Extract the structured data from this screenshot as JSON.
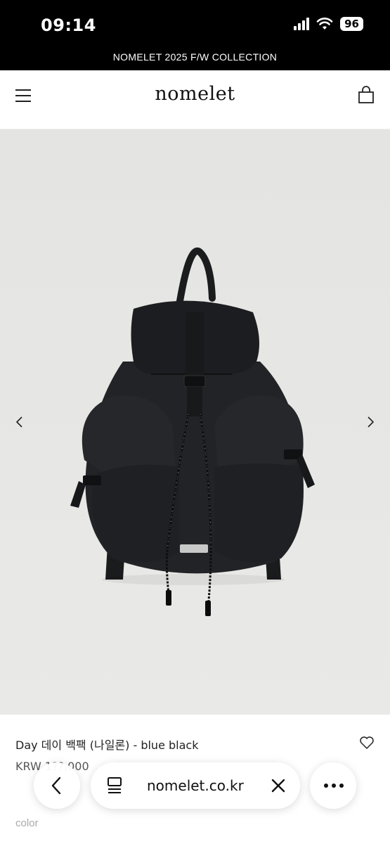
{
  "status_bar": {
    "time": "09:14",
    "battery": "96"
  },
  "announcement": {
    "text": "NOMELET 2025 F/W COLLECTION"
  },
  "header": {
    "logo": "nomelet"
  },
  "product": {
    "name": "Day 데이 백팩 (나일론) - blue black",
    "price": "KRW 1??,000",
    "option_label": "color"
  },
  "browser": {
    "url": "nomelet.co.kr"
  },
  "icons": {
    "menu": "hamburger-icon",
    "cart": "shopping-bag-icon",
    "prev": "chevron-left-icon",
    "next": "chevron-right-icon",
    "wish": "heart-icon",
    "back": "chevron-left-icon",
    "reader": "reader-icon",
    "close": "close-icon",
    "more": "more-icon"
  },
  "colors": {
    "bar_bg": "#000000",
    "gallery_bg": "#e6e6e4",
    "bag": "#1e1f21"
  }
}
